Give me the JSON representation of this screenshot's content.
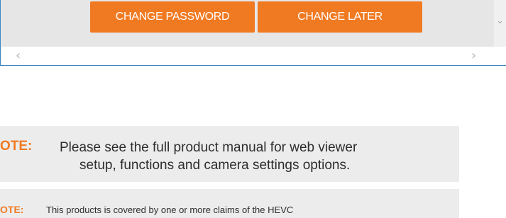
{
  "dialog": {
    "change_password_label": "CHANGE PASSWORD",
    "change_later_label": "CHANGE LATER"
  },
  "scrollbar": {
    "left_arrow": "‹",
    "right_arrow": "›",
    "down_arrow": "⌄"
  },
  "notes": [
    {
      "label": "OTE:",
      "line1": "Please see the full product manual for web viewer",
      "line2": "setup, functions and camera settings options."
    },
    {
      "label": "OTE:",
      "text": "This products is covered by one or more claims of the HEVC"
    }
  ],
  "colors": {
    "accent": "#f07a22",
    "frame_border": "#3b86c8",
    "note_background": "#ececec"
  }
}
